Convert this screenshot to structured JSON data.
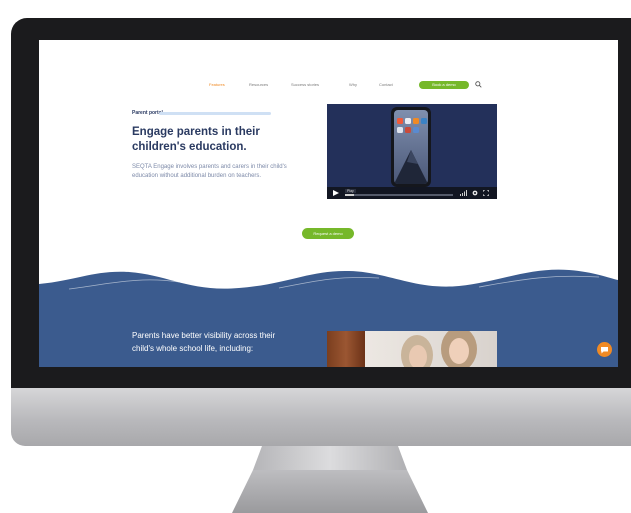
{
  "nav": {
    "items": [
      {
        "label": "Features",
        "active": true
      },
      {
        "label": "Resources",
        "active": false
      },
      {
        "label": "Success stories",
        "active": false
      },
      {
        "label": "Why",
        "active": false
      },
      {
        "label": "Contact",
        "active": false
      }
    ],
    "cta_label": "Book a demo"
  },
  "hero": {
    "section_label": "Parent portal",
    "headline": "Engage parents in their children's education.",
    "body": "SEQTA Engage involves parents and carers in their child's education without additional burden on teachers."
  },
  "video": {
    "badge": "Play",
    "progress": 0.08
  },
  "cta_button": {
    "label": "Request a demo"
  },
  "blue_section": {
    "heading": "Parents have better visibility across their child's whole school life, including:"
  },
  "colors": {
    "brand_navy": "#2a3a61",
    "wave_blue": "#3b5b8e",
    "accent_green": "#76b82a",
    "accent_orange": "#f08a24"
  },
  "icons": [
    "play-icon",
    "volume-icon",
    "gear-icon",
    "fullscreen-icon",
    "chat-icon",
    "search-icon"
  ]
}
